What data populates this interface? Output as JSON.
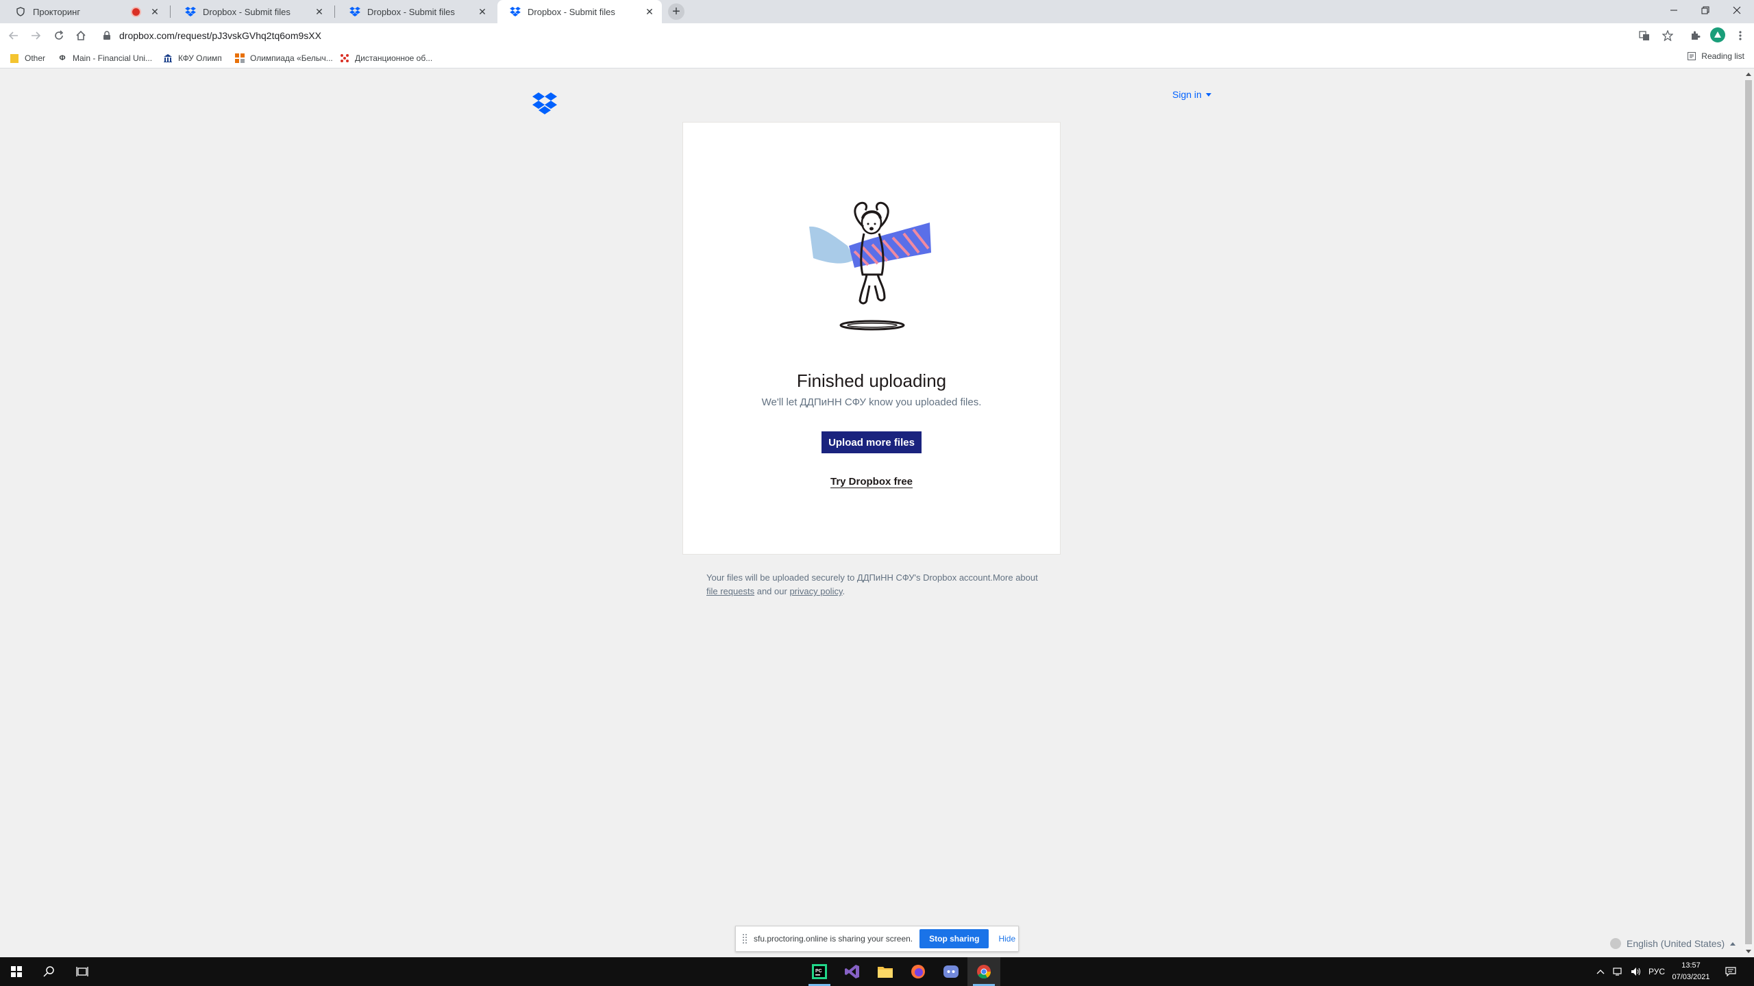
{
  "tabs": [
    {
      "title": "Прокторинг",
      "icon": "shield-icon",
      "recording": true
    },
    {
      "title": "Dropbox - Submit files",
      "icon": "dropbox-icon",
      "recording": false
    },
    {
      "title": "Dropbox - Submit files",
      "icon": "dropbox-icon",
      "recording": false
    },
    {
      "title": "Dropbox - Submit files",
      "icon": "dropbox-icon",
      "recording": false,
      "active": true
    }
  ],
  "toolbar": {
    "url": "dropbox.com/request/pJ3vskGVhq2tq6om9sXX"
  },
  "bookmarks": {
    "items": [
      {
        "label": "Other",
        "icon": "folder-icon"
      },
      {
        "label": "Main - Financial Uni...",
        "icon": "phi-icon"
      },
      {
        "label": "КФУ Олимп",
        "icon": "bank-icon"
      },
      {
        "label": "Олимпиада «Белыч...",
        "icon": "orange-grid-icon"
      },
      {
        "label": "Дистанционное об...",
        "icon": "dots-icon"
      }
    ],
    "reading_list": "Reading list"
  },
  "page": {
    "sign_in": "Sign in",
    "title": "Finished uploading",
    "subtitle": "We'll let ДДПиНН СФУ know you uploaded files.",
    "upload_button": "Upload more files",
    "try_link": "Try Dropbox free",
    "footnote_text": "Your files will be uploaded securely to ДДПиНН СФУ's Dropbox account.More about",
    "footnote_link1": "file requests",
    "footnote_and": "and our",
    "footnote_link2": "privacy policy",
    "footnote_end": ".",
    "language": "English (United States)"
  },
  "share_bar": {
    "message": "sfu.proctoring.online is sharing your screen.",
    "stop": "Stop sharing",
    "hide": "Hide"
  },
  "taskbar": {
    "lang": "РУС",
    "time": "13:57",
    "date": "07/03/2021"
  },
  "colors": {
    "dropbox_blue": "#0061fe",
    "button_navy": "#1a237e",
    "share_blue": "#1a73e8"
  }
}
